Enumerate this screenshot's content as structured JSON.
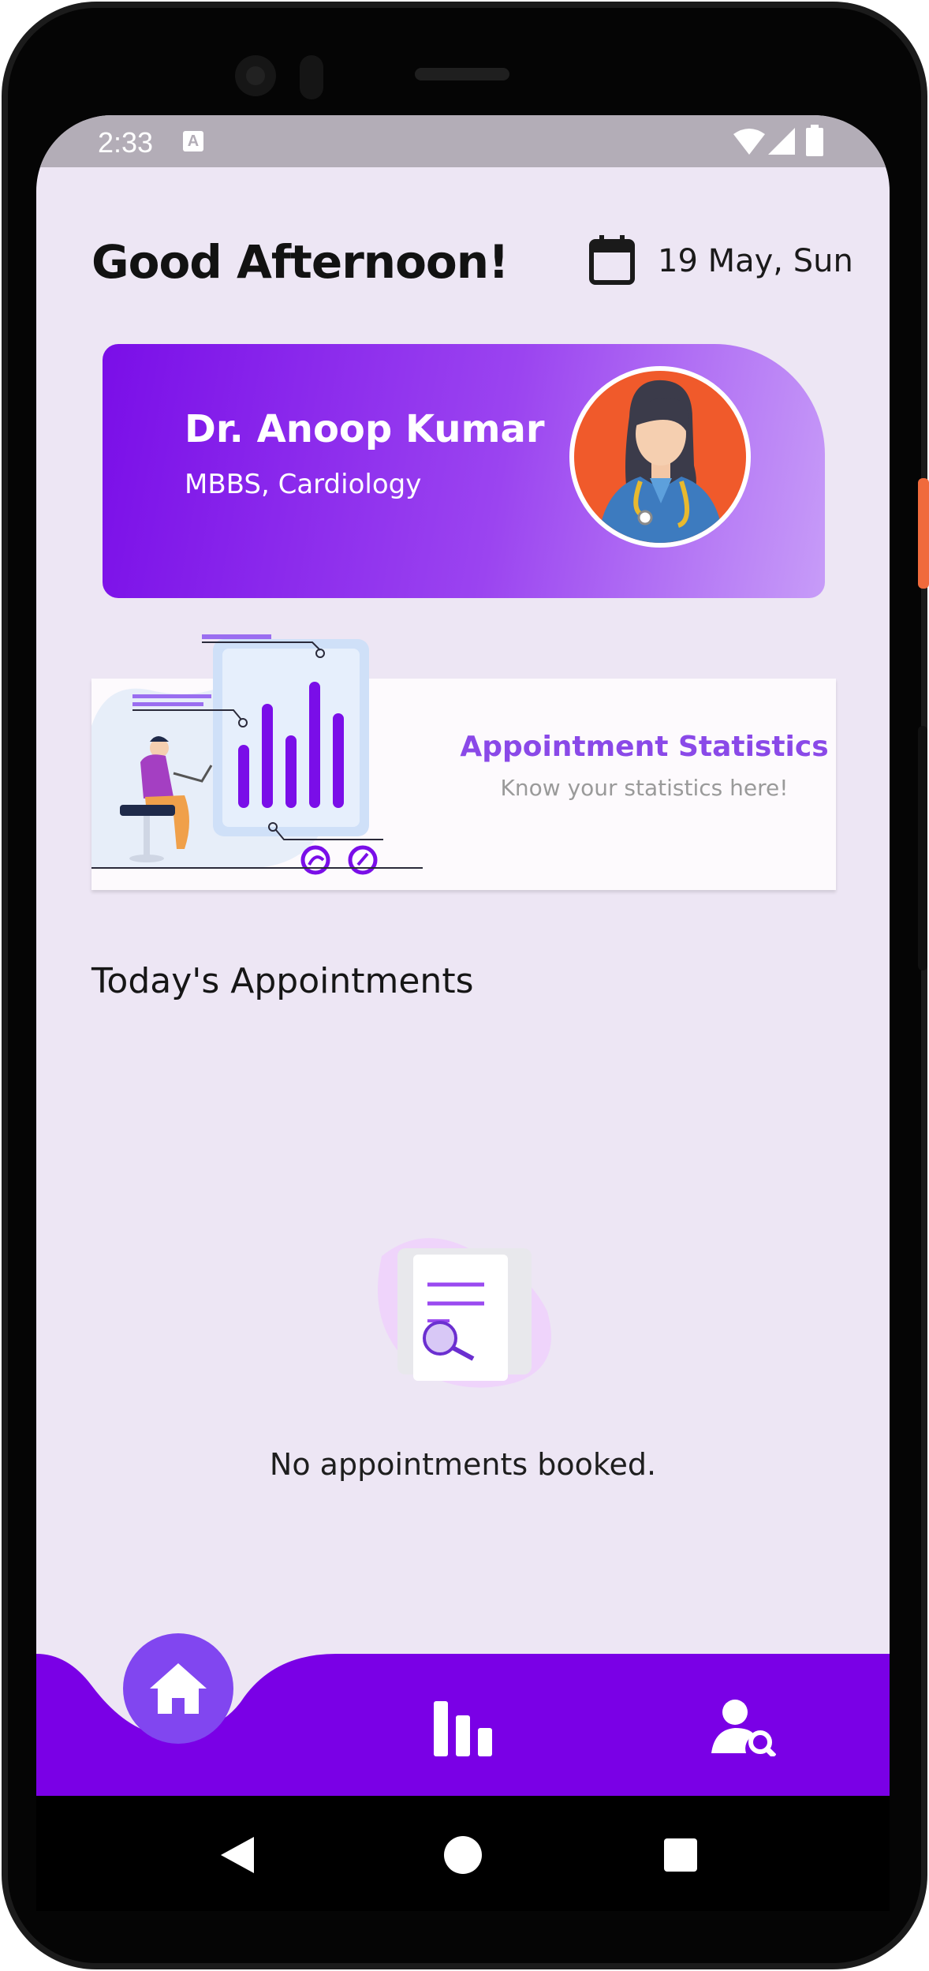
{
  "status_bar": {
    "time": "2:33",
    "app_icon_letter": "A"
  },
  "header": {
    "greeting": "Good Afternoon!",
    "date": "19 May, Sun"
  },
  "doctor": {
    "name": "Dr. Anoop Kumar",
    "specialization": "MBBS, Cardiology"
  },
  "stats_banner": {
    "title": "Appointment Statistics",
    "subtitle": "Know your statistics here!"
  },
  "appointments": {
    "section_title": "Today's Appointments",
    "empty_message": "No appointments booked."
  },
  "bottom_nav": {
    "items": [
      "home",
      "statistics",
      "search-patient"
    ],
    "active": "home"
  },
  "colors": {
    "primary": "#7a00e6",
    "accent": "#8146f0",
    "background": "#ede6f4",
    "avatar_bg": "#f05a2b"
  },
  "icons": [
    "wifi-icon",
    "signal-icon",
    "battery-icon",
    "calendar-icon",
    "home-icon",
    "bar-chart-icon",
    "user-search-icon",
    "back-icon",
    "home-circle-icon",
    "recents-icon"
  ]
}
